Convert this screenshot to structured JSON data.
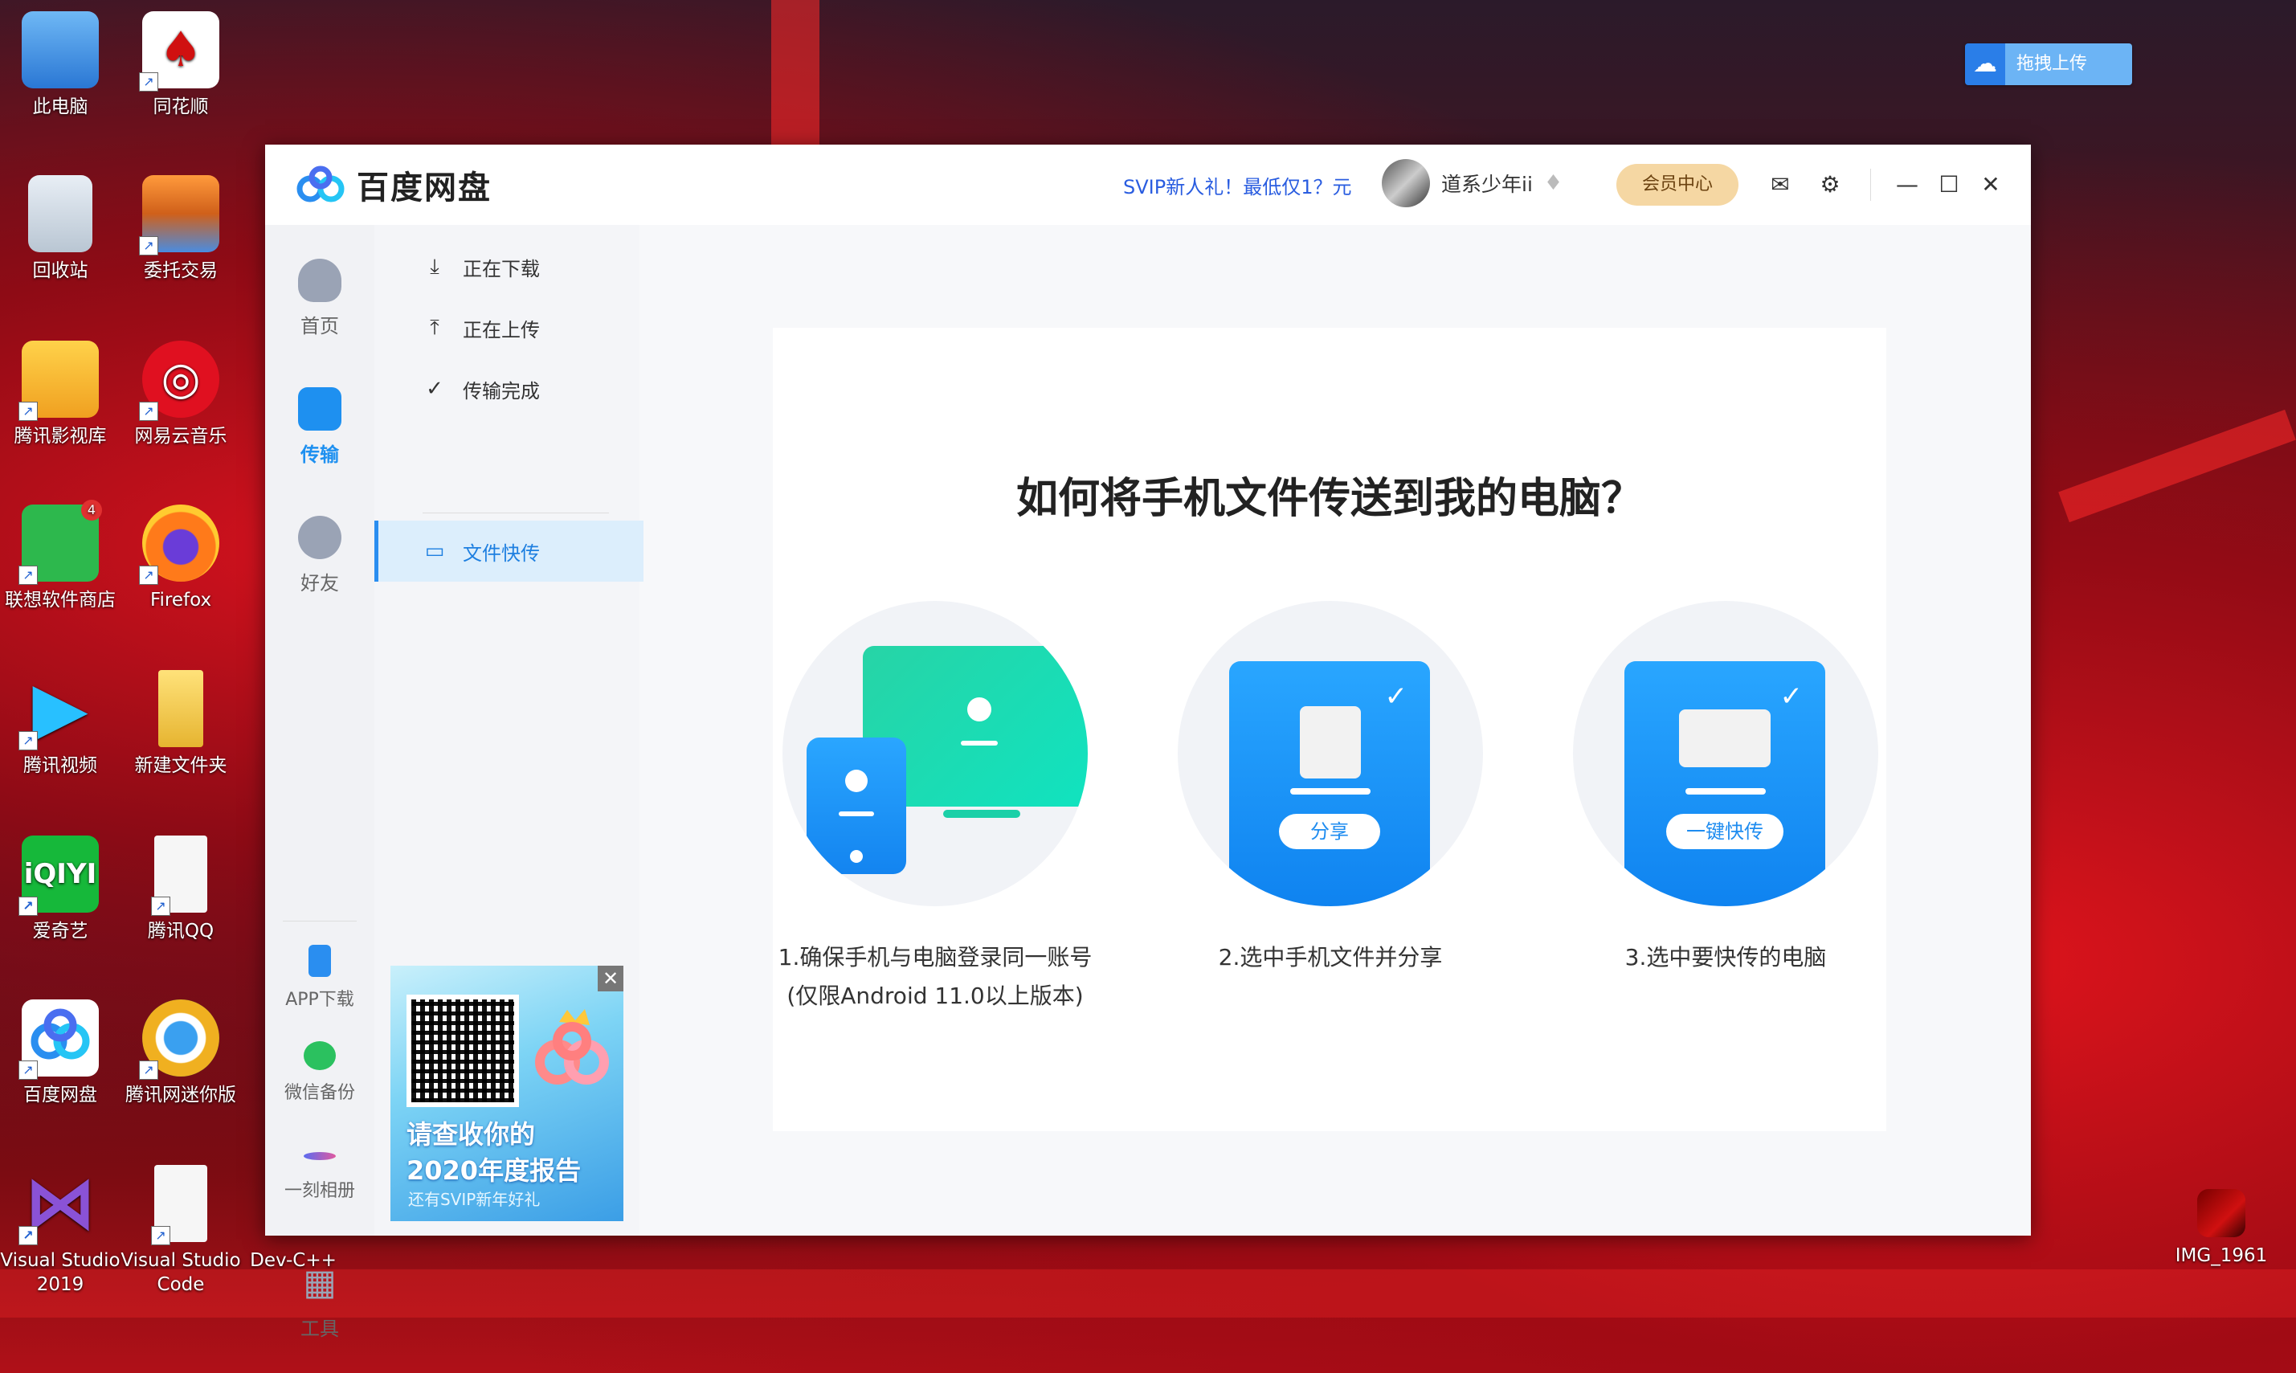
{
  "desktop": {
    "icons": [
      {
        "label": "此电脑"
      },
      {
        "label": "同花顺"
      },
      {
        "label": "回收站"
      },
      {
        "label": "委托交易"
      },
      {
        "label": "腾讯影视库"
      },
      {
        "label": "网易云音乐"
      },
      {
        "label": "联想软件商店",
        "badge": "4"
      },
      {
        "label": "Firefox"
      },
      {
        "label": "腾讯视频"
      },
      {
        "label": "新建文件夹"
      },
      {
        "label": "爱奇艺"
      },
      {
        "label": "腾讯QQ"
      },
      {
        "label": "百度网盘"
      },
      {
        "label": "腾讯网迷你版"
      },
      {
        "label": "Visual Studio 2019"
      },
      {
        "label": "Visual Studio Code"
      },
      {
        "label": "Dev-C++"
      },
      {
        "label": "IMG_1961"
      }
    ],
    "upload_widget": "拖拽上传"
  },
  "window": {
    "app_name": "百度网盘",
    "promo": "SVIP新人礼！最低仅1？元",
    "username": "道系少年ii",
    "vip_button": "会员中心",
    "icons": [
      "mail-icon",
      "settings-icon",
      "minimize-icon",
      "maximize-icon",
      "close-icon"
    ]
  },
  "rail": {
    "items": [
      {
        "label": "首页"
      },
      {
        "label": "传输",
        "active": true
      },
      {
        "label": "好友"
      },
      {
        "label": "APP下载"
      },
      {
        "label": "微信备份"
      },
      {
        "label": "一刻相册"
      },
      {
        "label": "工具"
      }
    ]
  },
  "transfer_menu": {
    "items": [
      {
        "label": "正在下载",
        "icon": "download-icon"
      },
      {
        "label": "正在上传",
        "icon": "upload-icon"
      },
      {
        "label": "传输完成",
        "icon": "check-circle-icon"
      },
      {
        "label": "文件快传",
        "icon": "monitor-icon",
        "active": true
      }
    ]
  },
  "ad": {
    "line1": "请查收你的",
    "line2": "2020年度报告",
    "line3": "还有SVIP新年好礼",
    "close": "✕"
  },
  "main": {
    "heading": "如何将手机文件传送到我的电脑？",
    "steps": [
      {
        "caption_line1": "1.确保手机与电脑登录同一账号",
        "caption_line2": "(仅限Android 11.0以上版本)"
      },
      {
        "caption_line1": "2.选中手机文件并分享",
        "button": "分享"
      },
      {
        "caption_line1": "3.选中要快传的电脑",
        "button": "一键快传"
      }
    ]
  }
}
